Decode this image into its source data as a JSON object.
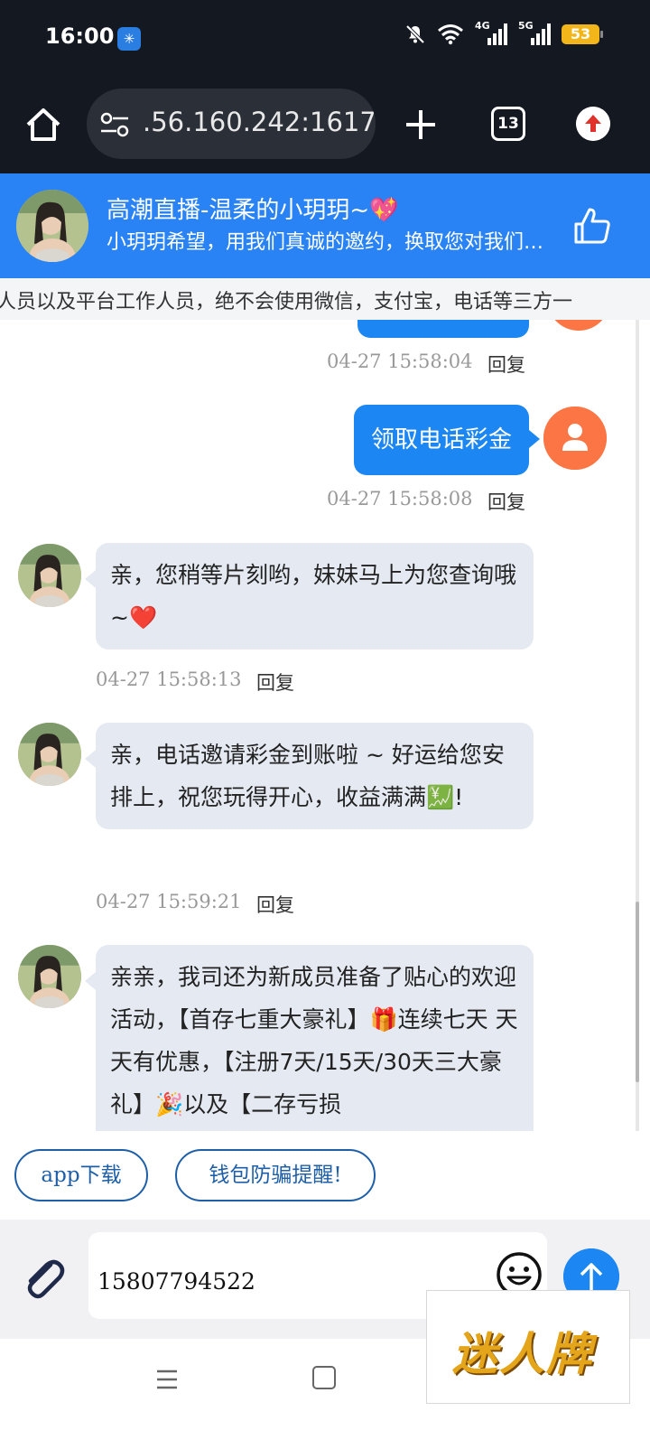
{
  "status_bar": {
    "time": "16:00",
    "battery": "53",
    "net_a": "4G",
    "net_b": "5G"
  },
  "browser": {
    "url": ".56.160.242:1617",
    "tab_count": "13"
  },
  "chat_header": {
    "title": "高潮直播-温柔的小玥玥~💖",
    "subtitle": "小玥玥希望，用我们真诚的邀约，换取您对我们的信任"
  },
  "notice": {
    "text": "人员以及平台工作人员，绝不会使用微信，支付宝，电话等三方一"
  },
  "messages": [
    {
      "sender": "user",
      "text": "",
      "time": "04-27 15:58:04",
      "reply": "回复"
    },
    {
      "sender": "user",
      "text": "领取电话彩金",
      "time": "04-27 15:58:08",
      "reply": "回复"
    },
    {
      "sender": "host",
      "text": "亲，您稍等片刻哟，妹妹马上为您查询哦~❤️",
      "time": "04-27 15:58:13",
      "reply": "回复"
    },
    {
      "sender": "host",
      "text": " 亲，电话邀请彩金到账啦 ~ 好运给您安排上，祝您玩得开心，收益满满💹!",
      "time": "04-27 15:59:21",
      "reply": "回复"
    },
    {
      "sender": "host",
      "text": "亲亲，我司还为新成员准备了贴心的欢迎活动，【首存七重大豪礼】🎁连续七天 天天有优惠，【注册7天/15天/30天三大豪礼】🎉以及【二存亏损",
      "time": "",
      "reply": ""
    }
  ],
  "quick_replies": [
    "app下载",
    "钱包防骗提醒!"
  ],
  "composer": {
    "input_value": "15807794522"
  },
  "watermark": {
    "text": "迷人牌"
  },
  "colors": {
    "header_blue": "#2a83f4",
    "bubble_blue": "#1c86f3",
    "user_avatar": "#fc7645",
    "incoming_bubble": "#e5eaf2"
  }
}
